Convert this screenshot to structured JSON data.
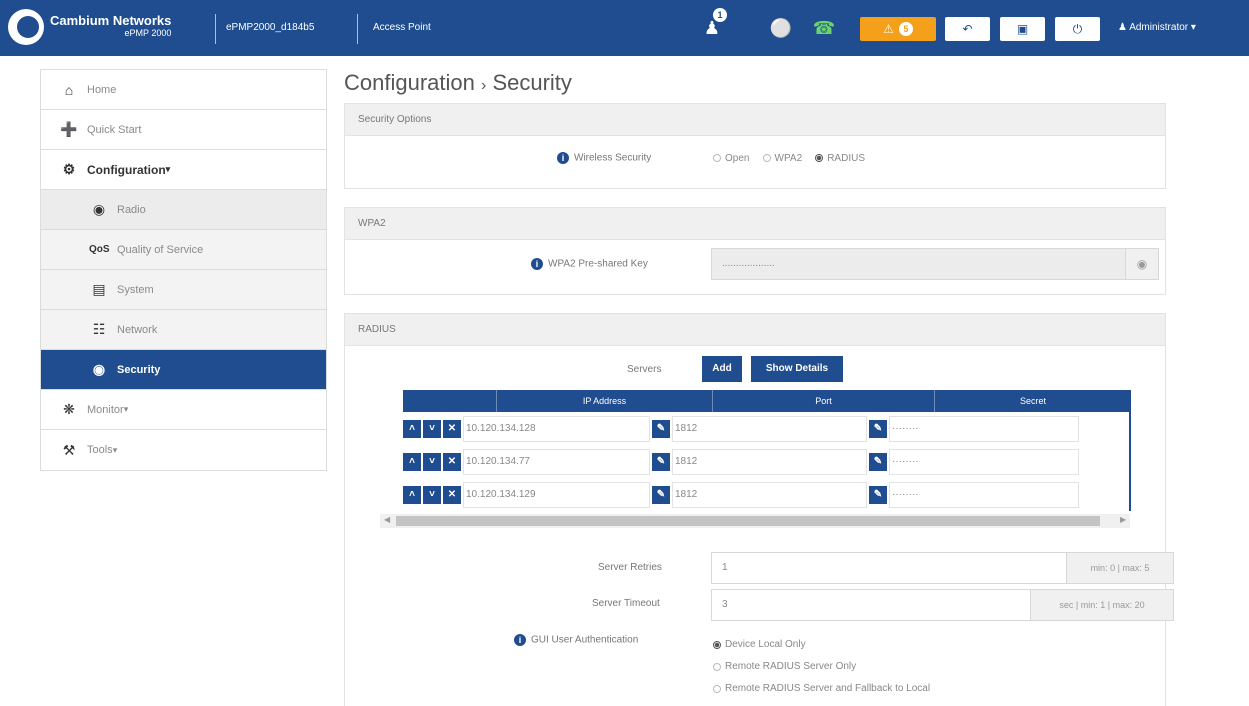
{
  "topbar": {
    "brand_name": "Cambium Networks",
    "brand_model": "ePMP 2000",
    "device_name": "ePMP2000_d184b5",
    "device_mode": "Access Point",
    "notification_count": "1",
    "alarm_count": "5",
    "user": "Administrator"
  },
  "sidebar": {
    "items": [
      {
        "label": "Home",
        "icon": "home-icon"
      },
      {
        "label": "Quick Start",
        "icon": "runner-icon"
      },
      {
        "label": "Configuration",
        "icon": "gear-icon"
      },
      {
        "label": "Radio",
        "icon": "radio-icon"
      },
      {
        "label": "Quality of Service",
        "icon": "qos-icon"
      },
      {
        "label": "System",
        "icon": "system-icon"
      },
      {
        "label": "Network",
        "icon": "network-icon"
      },
      {
        "label": "Security",
        "icon": "shield-icon"
      },
      {
        "label": "Monitor",
        "icon": "pulse-icon"
      },
      {
        "label": "Tools",
        "icon": "wrench-icon"
      }
    ]
  },
  "page": {
    "title": "Configuration",
    "title_sep": "›",
    "subtitle": "Security"
  },
  "security_options": {
    "header": "Security Options",
    "wireless_label": "Wireless Security",
    "options": [
      "Open",
      "WPA2",
      "RADIUS"
    ],
    "selected": "RADIUS"
  },
  "wpa2": {
    "header": "WPA2",
    "key_label": "WPA2 Pre-shared Key",
    "key_value": "..................."
  },
  "radius": {
    "header": "RADIUS",
    "servers_label": "Servers",
    "add_label": "Add",
    "show_details_label": "Show Details",
    "columns": [
      "IP Address",
      "Port",
      "Secret"
    ],
    "rows": [
      {
        "ip": "10.120.134.128",
        "port": "1812",
        "secret": "········"
      },
      {
        "ip": "10.120.134.77",
        "port": "1812",
        "secret": "········"
      },
      {
        "ip": "10.120.134.129",
        "port": "1812",
        "secret": "········"
      }
    ],
    "retries_label": "Server Retries",
    "retries_value": "1",
    "retries_hint": "min: 0 | max: 5",
    "timeout_label": "Server Timeout",
    "timeout_value": "3",
    "timeout_hint": "sec | min: 1 | max: 20",
    "gui_auth_label": "GUI User Authentication",
    "gui_auth_options": [
      "Device Local Only",
      "Remote RADIUS Server Only",
      "Remote RADIUS Server and Fallback to Local"
    ],
    "gui_auth_selected": "Device Local Only"
  },
  "colors": {
    "brand": "#1f4d8f",
    "accent": "#f5a01a"
  }
}
